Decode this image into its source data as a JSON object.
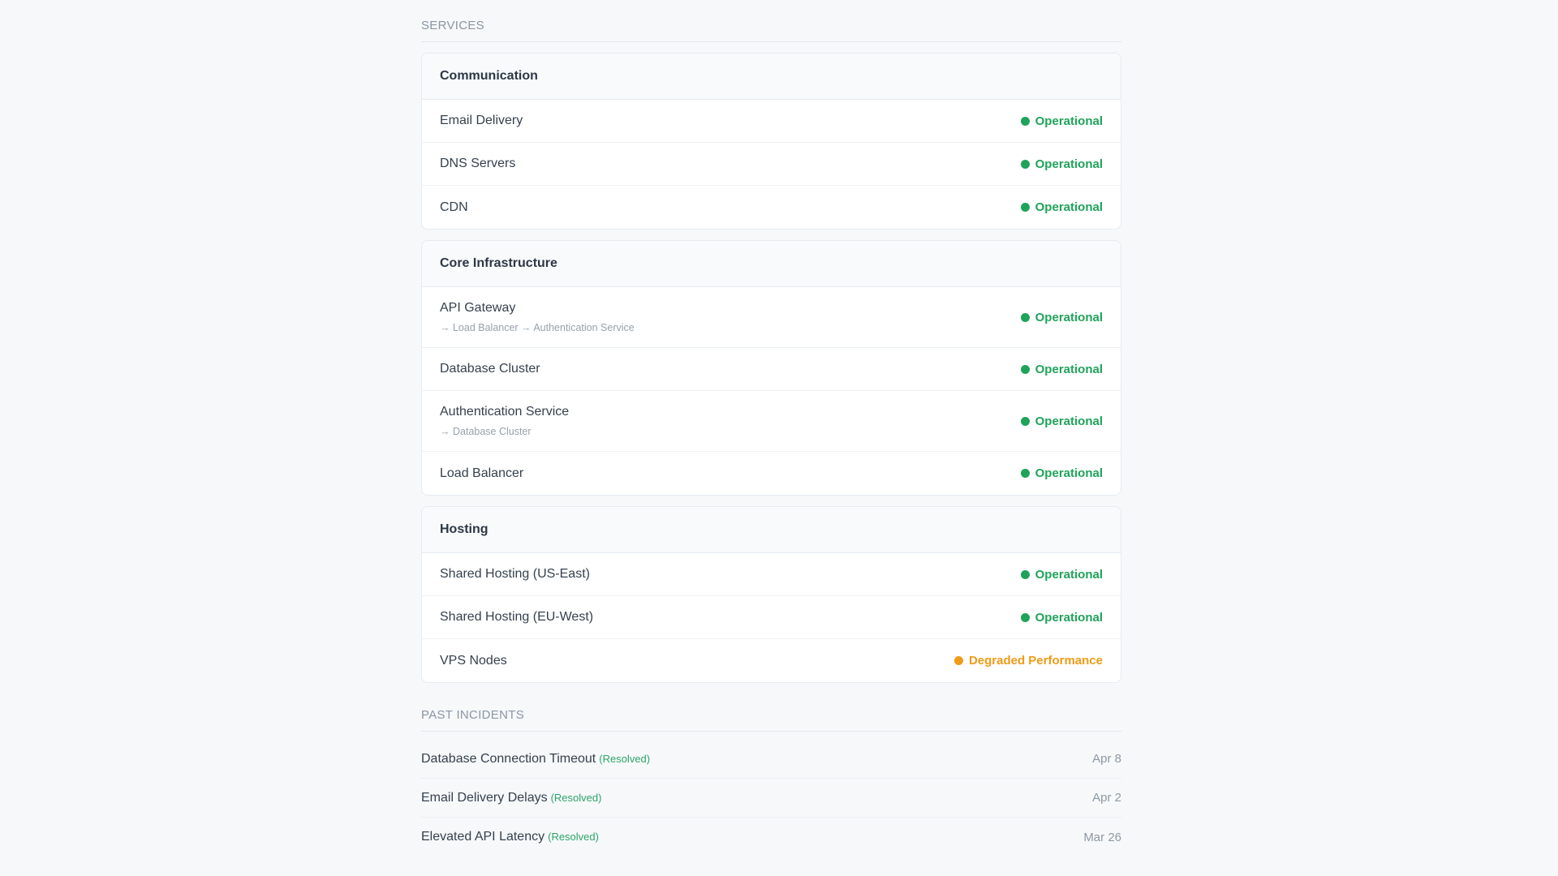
{
  "colors": {
    "operational": "#1fa35a",
    "degraded": "#ef9b16",
    "resolved": "#2ea567"
  },
  "services": {
    "header": "SERVICES",
    "groups": [
      {
        "title": "Communication",
        "items": [
          {
            "name": "Email Delivery",
            "deps": "",
            "status": "Operational",
            "state": "operational"
          },
          {
            "name": "DNS Servers",
            "deps": "",
            "status": "Operational",
            "state": "operational"
          },
          {
            "name": "CDN",
            "deps": "",
            "status": "Operational",
            "state": "operational"
          }
        ]
      },
      {
        "title": "Core Infrastructure",
        "items": [
          {
            "name": "API Gateway",
            "deps": "→ Load Balancer → Authentication Service",
            "status": "Operational",
            "state": "operational"
          },
          {
            "name": "Database Cluster",
            "deps": "",
            "status": "Operational",
            "state": "operational"
          },
          {
            "name": "Authentication Service",
            "deps": "→ Database Cluster",
            "status": "Operational",
            "state": "operational"
          },
          {
            "name": "Load Balancer",
            "deps": "",
            "status": "Operational",
            "state": "operational"
          }
        ]
      },
      {
        "title": "Hosting",
        "items": [
          {
            "name": "Shared Hosting (US-East)",
            "deps": "",
            "status": "Operational",
            "state": "operational"
          },
          {
            "name": "Shared Hosting (EU-West)",
            "deps": "",
            "status": "Operational",
            "state": "operational"
          },
          {
            "name": "VPS Nodes",
            "deps": "",
            "status": "Degraded Performance",
            "state": "degraded"
          }
        ]
      }
    ]
  },
  "incidents": {
    "header": "PAST INCIDENTS",
    "items": [
      {
        "title": "Database Connection Timeout",
        "tag": "(Resolved)",
        "date": "Apr 8"
      },
      {
        "title": "Email Delivery Delays",
        "tag": "(Resolved)",
        "date": "Apr 2"
      },
      {
        "title": "Elevated API Latency",
        "tag": "(Resolved)",
        "date": "Mar 26"
      }
    ]
  }
}
